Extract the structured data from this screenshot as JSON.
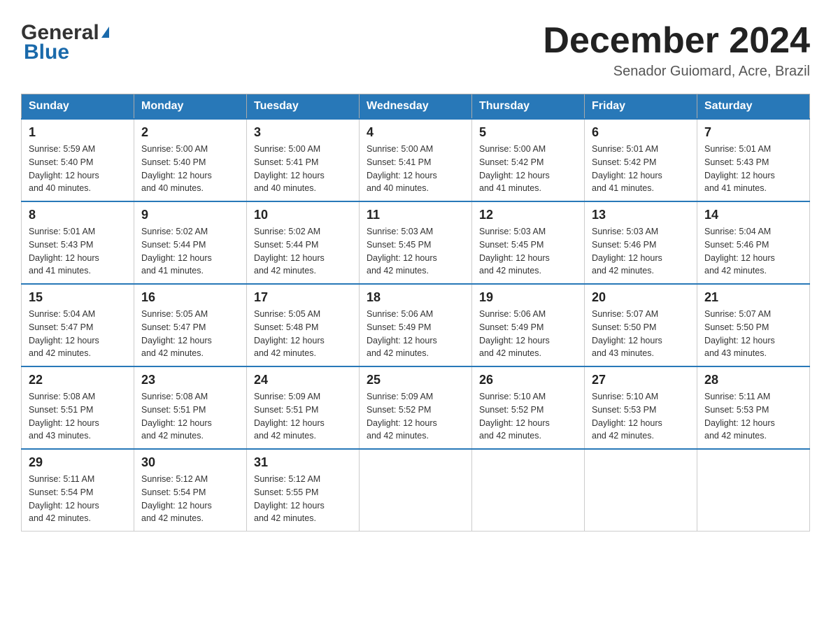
{
  "logo": {
    "text_general": "General",
    "text_blue": "Blue"
  },
  "header": {
    "month_year": "December 2024",
    "location": "Senador Guiomard, Acre, Brazil"
  },
  "days_of_week": [
    "Sunday",
    "Monday",
    "Tuesday",
    "Wednesday",
    "Thursday",
    "Friday",
    "Saturday"
  ],
  "weeks": [
    [
      {
        "day": "1",
        "sunrise": "5:59 AM",
        "sunset": "5:40 PM",
        "daylight": "12 hours and 40 minutes."
      },
      {
        "day": "2",
        "sunrise": "5:00 AM",
        "sunset": "5:40 PM",
        "daylight": "12 hours and 40 minutes."
      },
      {
        "day": "3",
        "sunrise": "5:00 AM",
        "sunset": "5:41 PM",
        "daylight": "12 hours and 40 minutes."
      },
      {
        "day": "4",
        "sunrise": "5:00 AM",
        "sunset": "5:41 PM",
        "daylight": "12 hours and 40 minutes."
      },
      {
        "day": "5",
        "sunrise": "5:00 AM",
        "sunset": "5:42 PM",
        "daylight": "12 hours and 41 minutes."
      },
      {
        "day": "6",
        "sunrise": "5:01 AM",
        "sunset": "5:42 PM",
        "daylight": "12 hours and 41 minutes."
      },
      {
        "day": "7",
        "sunrise": "5:01 AM",
        "sunset": "5:43 PM",
        "daylight": "12 hours and 41 minutes."
      }
    ],
    [
      {
        "day": "8",
        "sunrise": "5:01 AM",
        "sunset": "5:43 PM",
        "daylight": "12 hours and 41 minutes."
      },
      {
        "day": "9",
        "sunrise": "5:02 AM",
        "sunset": "5:44 PM",
        "daylight": "12 hours and 41 minutes."
      },
      {
        "day": "10",
        "sunrise": "5:02 AM",
        "sunset": "5:44 PM",
        "daylight": "12 hours and 42 minutes."
      },
      {
        "day": "11",
        "sunrise": "5:03 AM",
        "sunset": "5:45 PM",
        "daylight": "12 hours and 42 minutes."
      },
      {
        "day": "12",
        "sunrise": "5:03 AM",
        "sunset": "5:45 PM",
        "daylight": "12 hours and 42 minutes."
      },
      {
        "day": "13",
        "sunrise": "5:03 AM",
        "sunset": "5:46 PM",
        "daylight": "12 hours and 42 minutes."
      },
      {
        "day": "14",
        "sunrise": "5:04 AM",
        "sunset": "5:46 PM",
        "daylight": "12 hours and 42 minutes."
      }
    ],
    [
      {
        "day": "15",
        "sunrise": "5:04 AM",
        "sunset": "5:47 PM",
        "daylight": "12 hours and 42 minutes."
      },
      {
        "day": "16",
        "sunrise": "5:05 AM",
        "sunset": "5:47 PM",
        "daylight": "12 hours and 42 minutes."
      },
      {
        "day": "17",
        "sunrise": "5:05 AM",
        "sunset": "5:48 PM",
        "daylight": "12 hours and 42 minutes."
      },
      {
        "day": "18",
        "sunrise": "5:06 AM",
        "sunset": "5:49 PM",
        "daylight": "12 hours and 42 minutes."
      },
      {
        "day": "19",
        "sunrise": "5:06 AM",
        "sunset": "5:49 PM",
        "daylight": "12 hours and 42 minutes."
      },
      {
        "day": "20",
        "sunrise": "5:07 AM",
        "sunset": "5:50 PM",
        "daylight": "12 hours and 43 minutes."
      },
      {
        "day": "21",
        "sunrise": "5:07 AM",
        "sunset": "5:50 PM",
        "daylight": "12 hours and 43 minutes."
      }
    ],
    [
      {
        "day": "22",
        "sunrise": "5:08 AM",
        "sunset": "5:51 PM",
        "daylight": "12 hours and 43 minutes."
      },
      {
        "day": "23",
        "sunrise": "5:08 AM",
        "sunset": "5:51 PM",
        "daylight": "12 hours and 42 minutes."
      },
      {
        "day": "24",
        "sunrise": "5:09 AM",
        "sunset": "5:51 PM",
        "daylight": "12 hours and 42 minutes."
      },
      {
        "day": "25",
        "sunrise": "5:09 AM",
        "sunset": "5:52 PM",
        "daylight": "12 hours and 42 minutes."
      },
      {
        "day": "26",
        "sunrise": "5:10 AM",
        "sunset": "5:52 PM",
        "daylight": "12 hours and 42 minutes."
      },
      {
        "day": "27",
        "sunrise": "5:10 AM",
        "sunset": "5:53 PM",
        "daylight": "12 hours and 42 minutes."
      },
      {
        "day": "28",
        "sunrise": "5:11 AM",
        "sunset": "5:53 PM",
        "daylight": "12 hours and 42 minutes."
      }
    ],
    [
      {
        "day": "29",
        "sunrise": "5:11 AM",
        "sunset": "5:54 PM",
        "daylight": "12 hours and 42 minutes."
      },
      {
        "day": "30",
        "sunrise": "5:12 AM",
        "sunset": "5:54 PM",
        "daylight": "12 hours and 42 minutes."
      },
      {
        "day": "31",
        "sunrise": "5:12 AM",
        "sunset": "5:55 PM",
        "daylight": "12 hours and 42 minutes."
      },
      null,
      null,
      null,
      null
    ]
  ],
  "labels": {
    "sunrise": "Sunrise:",
    "sunset": "Sunset:",
    "daylight": "Daylight:"
  }
}
